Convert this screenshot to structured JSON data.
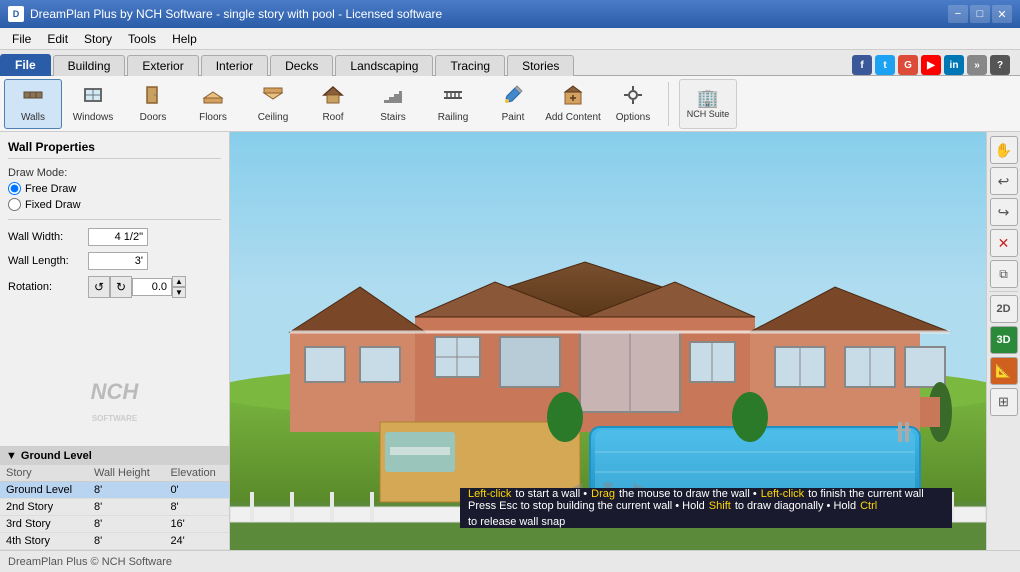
{
  "titlebar": {
    "title": "DreamPlan Plus by NCH Software - single story with pool - Licensed software",
    "controls": {
      "minimize": "−",
      "maximize": "□",
      "close": "✕"
    }
  },
  "menubar": {
    "items": [
      "File",
      "Edit",
      "Story",
      "Tools",
      "Help"
    ]
  },
  "tabs": {
    "active": "File",
    "items": [
      "File",
      "Building",
      "Exterior",
      "Interior",
      "Decks",
      "Landscaping",
      "Tracing",
      "Stories"
    ]
  },
  "toolbar": {
    "buttons": [
      {
        "id": "walls",
        "label": "Walls",
        "icon": "🧱"
      },
      {
        "id": "windows",
        "label": "Windows",
        "icon": "🪟"
      },
      {
        "id": "doors",
        "label": "Doors",
        "icon": "🚪"
      },
      {
        "id": "floors",
        "label": "Floors",
        "icon": "⬜"
      },
      {
        "id": "ceiling",
        "label": "Ceiling",
        "icon": "⬛"
      },
      {
        "id": "roof",
        "label": "Roof",
        "icon": "🏠"
      },
      {
        "id": "stairs",
        "label": "Stairs",
        "icon": "📐"
      },
      {
        "id": "railing",
        "label": "Railing",
        "icon": "⚓"
      },
      {
        "id": "paint",
        "label": "Paint",
        "icon": "🎨"
      },
      {
        "id": "add-content",
        "label": "Add Content",
        "icon": "📦"
      },
      {
        "id": "options",
        "label": "Options",
        "icon": "⚙️"
      }
    ],
    "nch_suite": "NCH Suite"
  },
  "wall_properties": {
    "title": "Wall Properties",
    "draw_mode_label": "Draw Mode:",
    "free_draw": "Free Draw",
    "fixed_draw": "Fixed Draw",
    "wall_width_label": "Wall Width:",
    "wall_width_value": "4 1/2\"",
    "wall_length_label": "Wall Length:",
    "wall_length_value": "3'",
    "rotation_label": "Rotation:",
    "rotation_value": "0.0"
  },
  "nch_logo": "NCH",
  "ground_level": {
    "title": "Ground Level",
    "table_headers": [
      "Story",
      "Wall Height",
      "Elevation"
    ],
    "rows": [
      {
        "story": "Ground Level",
        "wall_height": "8'",
        "elevation": "0'"
      },
      {
        "story": "2nd Story",
        "wall_height": "8'",
        "elevation": "8'"
      },
      {
        "story": "3rd Story",
        "wall_height": "8'",
        "elevation": "16'"
      },
      {
        "story": "4th Story",
        "wall_height": "8'",
        "elevation": "24'"
      }
    ]
  },
  "status_messages": {
    "line1_parts": [
      {
        "text": "Left-click",
        "style": "yellow"
      },
      {
        "text": " to start a wall • ",
        "style": "normal"
      },
      {
        "text": "Drag",
        "style": "yellow"
      },
      {
        "text": " the mouse to draw the wall • ",
        "style": "normal"
      },
      {
        "text": "Left-click",
        "style": "yellow"
      },
      {
        "text": " to finish the current wall",
        "style": "normal"
      }
    ],
    "line2_parts": [
      {
        "text": "Press Esc to stop building the current wall • Hold ",
        "style": "normal"
      },
      {
        "text": "Shift",
        "style": "yellow"
      },
      {
        "text": " to draw diagonally • Hold ",
        "style": "normal"
      },
      {
        "text": "Ctrl",
        "style": "yellow"
      },
      {
        "text": " to release wall snap",
        "style": "normal"
      }
    ]
  },
  "bottom_bar_text": "DreamPlan Plus © NCH Software",
  "right_tools": [
    {
      "id": "hand",
      "icon": "✋",
      "active": false
    },
    {
      "id": "undo",
      "icon": "↩",
      "active": false
    },
    {
      "id": "redo",
      "icon": "↪",
      "active": false
    },
    {
      "id": "delete",
      "icon": "✕",
      "active": false,
      "red": true
    },
    {
      "id": "copy",
      "icon": "⧉",
      "active": false
    },
    {
      "id": "2d",
      "icon": "2D",
      "active": false
    },
    {
      "id": "3d",
      "icon": "◈",
      "active": false,
      "green": true
    },
    {
      "id": "measure",
      "icon": "📏",
      "active": false,
      "orange": true
    },
    {
      "id": "grid",
      "icon": "⊞",
      "active": false
    }
  ],
  "social": {
    "icons": [
      {
        "id": "facebook",
        "label": "f",
        "color": "#3b5998"
      },
      {
        "id": "twitter",
        "label": "t",
        "color": "#1da1f2"
      },
      {
        "id": "google",
        "label": "G",
        "color": "#dd4b39"
      },
      {
        "id": "youtube",
        "label": "▶",
        "color": "#ff0000"
      },
      {
        "id": "linkedin",
        "label": "in",
        "color": "#0077b5"
      }
    ]
  }
}
